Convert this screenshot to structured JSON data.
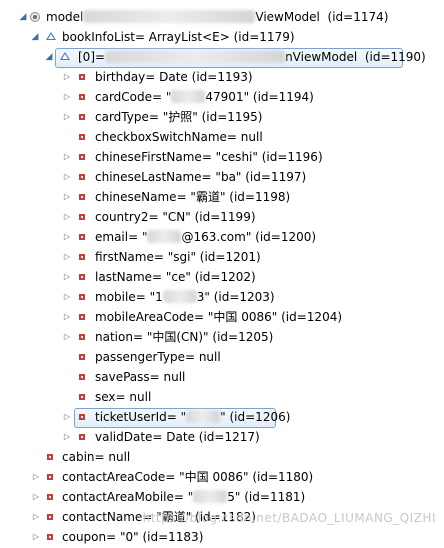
{
  "tree": {
    "model": {
      "name_prefix": "model",
      "name_suffix": "ViewModel",
      "id": "(id=1174)"
    },
    "bookInfoList": {
      "text": "bookInfoList= ArrayList<E>  (id=1179)"
    },
    "item0": {
      "prefix": "[0]=",
      "suffix": "nViewModel",
      "id": "(id=1190)"
    },
    "fields": [
      {
        "text": "birthday= Date  (id=1193)",
        "expandable": true
      },
      {
        "text_pre": "cardCode= \"",
        "text_post": "47901\" (id=1194)",
        "expandable": true,
        "redacted": true
      },
      {
        "text": "cardType= \"护照\" (id=1195)",
        "expandable": true
      },
      {
        "text": "checkboxSwitchName= null",
        "expandable": false
      },
      {
        "text": "chineseFirstName= \"ceshi\" (id=1196)",
        "expandable": true
      },
      {
        "text": "chineseLastName= \"ba\" (id=1197)",
        "expandable": true
      },
      {
        "text": "chineseName= \"霸道\" (id=1198)",
        "expandable": true
      },
      {
        "text": "country2= \"CN\" (id=1199)",
        "expandable": true
      },
      {
        "text_pre": "email= \"",
        "text_post": "@163.com\" (id=1200)",
        "expandable": true,
        "redacted": true
      },
      {
        "text": "firstName= \"sgi\" (id=1201)",
        "expandable": true
      },
      {
        "text": "lastName= \"ce\" (id=1202)",
        "expandable": true
      },
      {
        "text_pre": "mobile= \"1",
        "text_post": "3\" (id=1203)",
        "expandable": true,
        "redacted": true
      },
      {
        "text": "mobileAreaCode= \"中国 0086\" (id=1204)",
        "expandable": true
      },
      {
        "text": "nation= \"中国(CN)\" (id=1205)",
        "expandable": true
      },
      {
        "text": "passengerType= null",
        "expandable": false
      },
      {
        "text": "savePass= null",
        "expandable": false
      },
      {
        "text": "sex= null",
        "expandable": false
      },
      {
        "text_pre": "ticketUserId= \"",
        "text_post": "\" (id=1206)",
        "expandable": true,
        "redacted": true,
        "selected": true
      },
      {
        "text": "validDate= Date  (id=1217)",
        "expandable": true
      }
    ],
    "model_fields": [
      {
        "text": "cabin= null",
        "expandable": false
      },
      {
        "text": "contactAreaCode= \"中国 0086\" (id=1180)",
        "expandable": true
      },
      {
        "text_pre": "contactAreaMobile= \"",
        "text_post": "5\" (id=1181)",
        "expandable": true,
        "redacted": true
      },
      {
        "text": "contactName= \"霸道\" (id=1182)",
        "expandable": true
      },
      {
        "text": "coupon= \"0\" (id=1183)",
        "expandable": true
      }
    ]
  },
  "watermark": "https://blog.csdn.net/BADAO_LIUMANG_QIZHI"
}
